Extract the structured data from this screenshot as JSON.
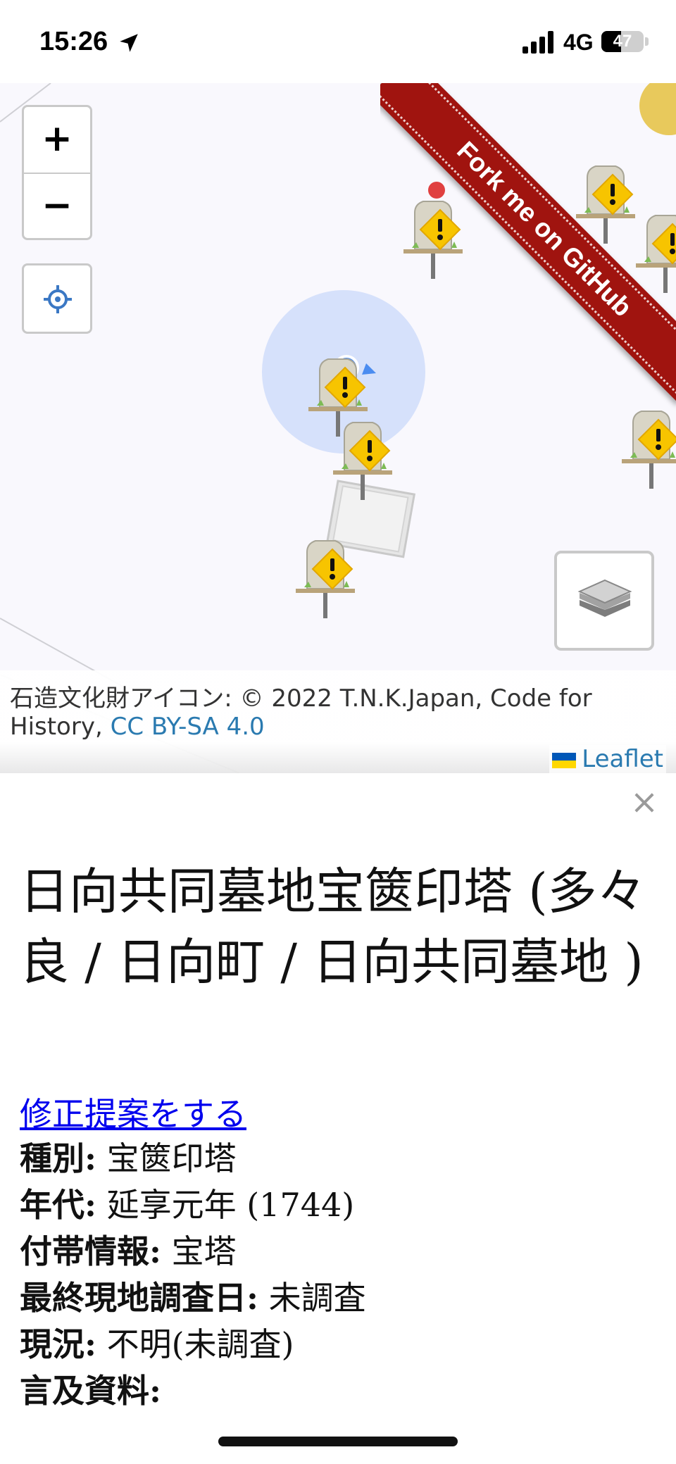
{
  "status_bar": {
    "time": "15:26",
    "network": "4G",
    "battery_level": "47",
    "battery_fraction": 0.47
  },
  "map": {
    "zoom_in_label": "+",
    "zoom_out_label": "−",
    "fork_ribbon": "Fork me on GitHub",
    "attribution_prefix": "石造文化財アイコン: © 2022 T.N.K.Japan, Code for",
    "attribution_line2_prefix": "History, ",
    "attribution_license": "CC BY-SA 4.0",
    "leaflet_label": "Leaflet",
    "colors": {
      "ribbon": "#a0140f",
      "marker_warning": "#f7c400",
      "accuracy_circle": "#c8d8fa",
      "locate_icon": "#3b78c4"
    }
  },
  "panel": {
    "close_label": "×",
    "title": "日向共同墓地宝篋印塔 (多々良 / 日向町 / 日向共同墓地 )",
    "suggest_link": "修正提案をする",
    "fields": [
      {
        "label": "種別:",
        "value": " 宝篋印塔"
      },
      {
        "label": "年代:",
        "value": " 延享元年 (1744)"
      },
      {
        "label": "付帯情報:",
        "value": " 宝塔"
      },
      {
        "label": "最終現地調査日:",
        "value": " 未調査"
      },
      {
        "label": "現況:",
        "value": " 不明(未調査)"
      },
      {
        "label": "言及資料:",
        "value": ""
      }
    ]
  }
}
